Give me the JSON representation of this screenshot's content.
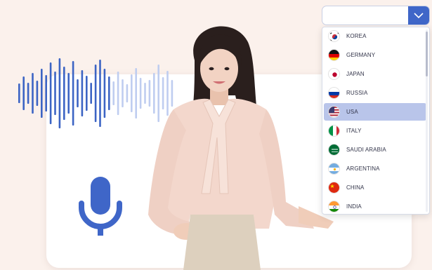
{
  "dropdown": {
    "selected_value": "",
    "arrow_icon": "chevron-down-icon",
    "accent": "#3f66c8"
  },
  "languages": [
    {
      "label": "KOREA",
      "icon": "flag-korea-icon"
    },
    {
      "label": "GERMANY",
      "icon": "flag-germany-icon"
    },
    {
      "label": "JAPAN",
      "icon": "flag-japan-icon"
    },
    {
      "label": "RUSSIA",
      "icon": "flag-russia-icon"
    },
    {
      "label": "USA",
      "icon": "flag-usa-icon",
      "selected": true
    },
    {
      "label": "ITALY",
      "icon": "flag-italy-icon"
    },
    {
      "label": "SAUDI ARABIA",
      "icon": "flag-saudi-arabia-icon"
    },
    {
      "label": "ARGENTINA",
      "icon": "flag-argentina-icon"
    },
    {
      "label": "CHINA",
      "icon": "flag-china-icon"
    },
    {
      "label": "INDIA",
      "icon": "flag-india-icon"
    }
  ],
  "decor": {
    "microphone_icon": "microphone-icon",
    "waveform_icon": "sound-wave-icon",
    "presenter_image": "presenter-woman-image",
    "colors": {
      "background": "#fbf1ec",
      "wave_dark": "#3c64c4",
      "wave_light": "#bfcdf0",
      "mic": "#3f66c8",
      "selected_row": "#b9c5ea"
    }
  }
}
